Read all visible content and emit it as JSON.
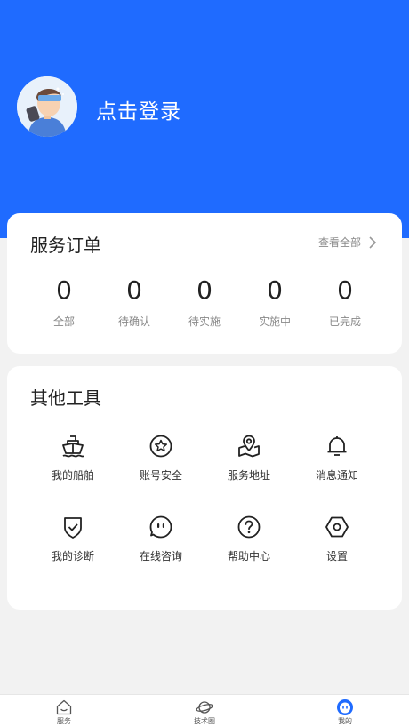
{
  "header": {
    "login_text": "点击登录",
    "background_color": "#1f6bff"
  },
  "orders": {
    "title": "服务订单",
    "view_all": "查看全部",
    "stats": [
      {
        "value": "0",
        "label": "全部"
      },
      {
        "value": "0",
        "label": "待确认"
      },
      {
        "value": "0",
        "label": "待实施"
      },
      {
        "value": "0",
        "label": "实施中"
      },
      {
        "value": "0",
        "label": "已完成"
      }
    ]
  },
  "tools": {
    "title": "其他工具",
    "items": [
      {
        "label": "我的船舶",
        "icon": "ship-icon"
      },
      {
        "label": "账号安全",
        "icon": "star-badge-icon"
      },
      {
        "label": "服务地址",
        "icon": "map-pin-icon"
      },
      {
        "label": "消息通知",
        "icon": "bell-icon"
      },
      {
        "label": "我的诊断",
        "icon": "shield-check-icon"
      },
      {
        "label": "在线咨询",
        "icon": "chat-face-icon"
      },
      {
        "label": "帮助中心",
        "icon": "help-circle-icon"
      },
      {
        "label": "设置",
        "icon": "hex-settings-icon"
      }
    ]
  },
  "tabbar": {
    "items": [
      {
        "label": "服务",
        "icon": "home-icon"
      },
      {
        "label": "技术圈",
        "icon": "planet-icon"
      },
      {
        "label": "我的",
        "icon": "profile-face-icon",
        "active": true
      }
    ]
  }
}
